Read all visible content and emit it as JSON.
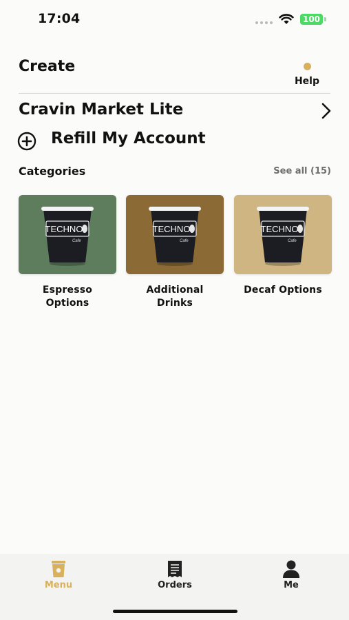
{
  "status_bar": {
    "time": "17:04",
    "battery": "100"
  },
  "header": {
    "title": "Create",
    "help_label": "Help"
  },
  "market": {
    "name": "Cravin Market Lite"
  },
  "refill": {
    "label": "Refill My Account"
  },
  "categories": {
    "title": "Categories",
    "see_all": "See all (15)",
    "items": [
      {
        "line1": "Espresso",
        "line2": "Options",
        "color": "#5d7d5c"
      },
      {
        "line1": "Additional",
        "line2": "Drinks",
        "color": "#8c6a35"
      },
      {
        "line1": "Decaf Options",
        "line2": "",
        "color": "#cfb581"
      }
    ],
    "cup_logo": "TECHNO",
    "cup_sub": "Cafe"
  },
  "tab_bar": {
    "tabs": [
      {
        "label": "Menu",
        "icon": "coffee-cup-icon",
        "active": true
      },
      {
        "label": "Orders",
        "icon": "receipt-icon",
        "active": false
      },
      {
        "label": "Me",
        "icon": "person-icon",
        "active": false
      }
    ],
    "active_color": "#d9b15c",
    "inactive_color": "#222222"
  },
  "colors": {
    "accent": "#d9b15c",
    "battery": "#4cd964"
  }
}
